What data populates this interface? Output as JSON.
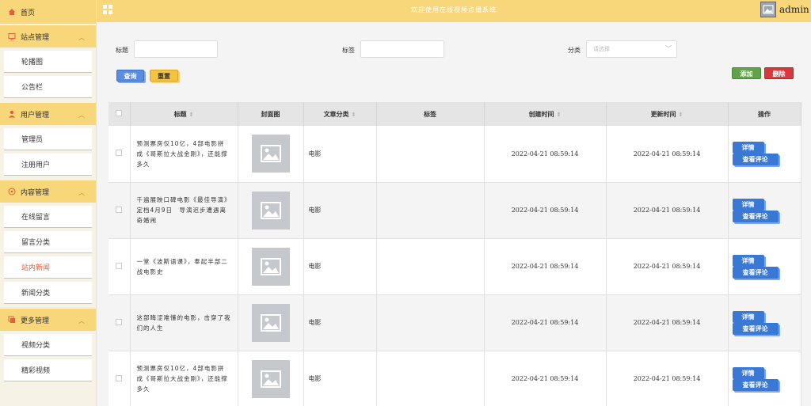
{
  "topbar": {
    "title": "欢迎使用在线视频点播系统",
    "username": "admin"
  },
  "sidebar": {
    "home": "首页",
    "groups": [
      {
        "label": "站点管理",
        "icon": "monitor-icon",
        "items": [
          "轮播图",
          "公告栏"
        ]
      },
      {
        "label": "用户管理",
        "icon": "user-icon",
        "items": [
          "管理员",
          "注册用户"
        ]
      },
      {
        "label": "内容管理",
        "icon": "compass-icon",
        "items": [
          "在线留言",
          "留言分类",
          "站内新闻",
          "新闻分类"
        ]
      },
      {
        "label": "更多管理",
        "icon": "copy-icon",
        "items": [
          "视频分类",
          "精彩视频"
        ]
      }
    ],
    "active_item": "站内新闻"
  },
  "filters": {
    "title_label": "标题",
    "title_value": "",
    "tag_label": "标签",
    "tag_value": "",
    "category_label": "分类",
    "category_placeholder": "请选择"
  },
  "buttons": {
    "query": "查询",
    "reset": "重置",
    "add": "添加",
    "delete": "删除"
  },
  "table": {
    "headers": {
      "title": "标题",
      "cover": "封面图",
      "category": "文章分类",
      "tags": "标签",
      "created": "创建时间",
      "updated": "更新时间",
      "actions": "操作"
    },
    "rows": [
      {
        "title": "预测票房仅10亿，4部电影拼成《哥斯拉大战金刚》，还能撑多久",
        "category": "电影",
        "tags": "",
        "created": "2022-04-21 08:59:14",
        "updated": "2022-04-21 08:59:14"
      },
      {
        "title": "千遍展映口碑电影《最佳导演》定档4月9日　导演迟步遭遇离奇婚闹",
        "category": "电影",
        "tags": "",
        "created": "2022-04-21 08:59:14",
        "updated": "2022-04-21 08:59:14"
      },
      {
        "title": "一堂《波斯语课》，奉起半部二战电影史",
        "category": "电影",
        "tags": "",
        "created": "2022-04-21 08:59:14",
        "updated": "2022-04-21 08:59:14"
      },
      {
        "title": "这部晦涩难懂的电影，击穿了我们的人生",
        "category": "电影",
        "tags": "",
        "created": "2022-04-21 08:59:14",
        "updated": "2022-04-21 08:59:14"
      },
      {
        "title": "预测票房仅10亿，4部电影拼成《哥斯拉大战金刚》，还能撑多久",
        "category": "电影",
        "tags": "",
        "created": "2022-04-21 08:59:14",
        "updated": "2022-04-21 08:59:14"
      }
    ],
    "row_actions": {
      "detail": "详情",
      "comments": "查看评论"
    }
  }
}
